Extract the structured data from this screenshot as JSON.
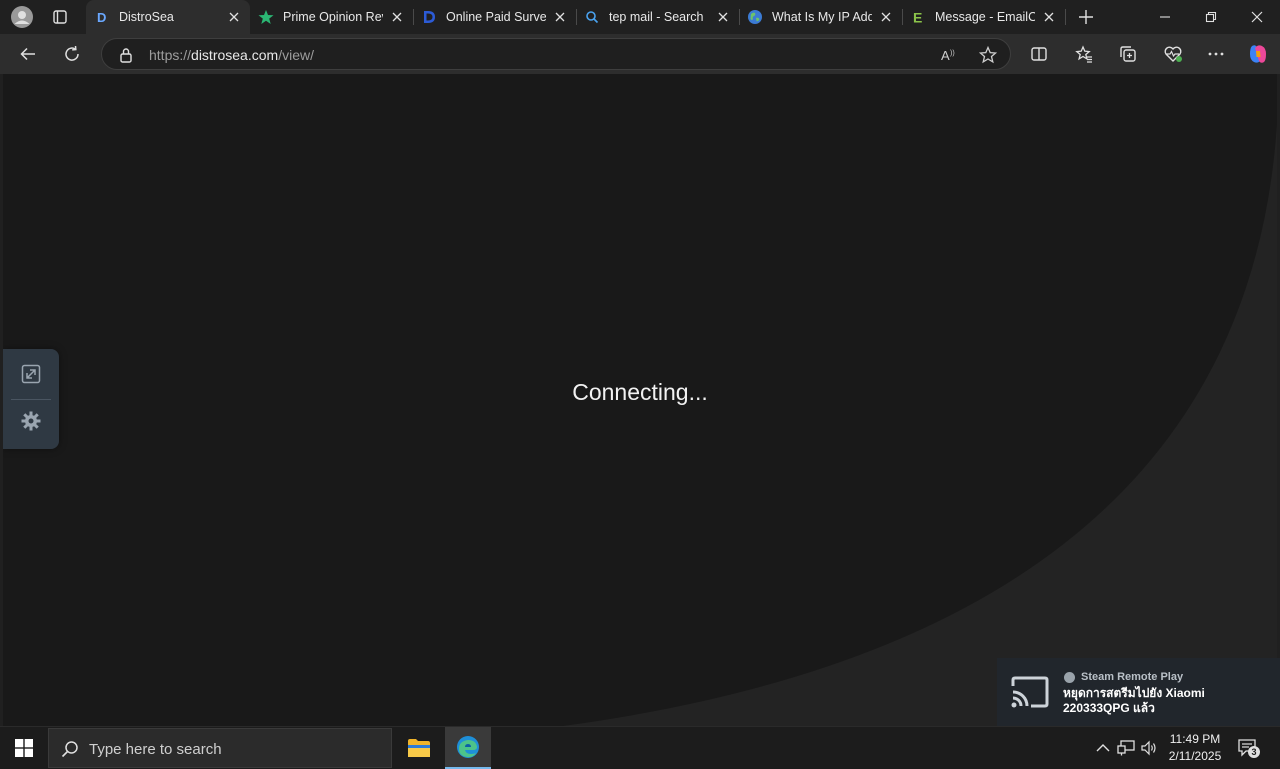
{
  "browser": {
    "tabs": [
      {
        "title": "DistroSea",
        "favicon": "distrosea-d-icon",
        "active": true
      },
      {
        "title": "Prime Opinion Revi",
        "favicon": "green-star-icon"
      },
      {
        "title": "Online Paid Survey",
        "favicon": "blue-d-logo-icon"
      },
      {
        "title": "tep mail - Search",
        "favicon": "search-icon"
      },
      {
        "title": "What Is My IP Add",
        "favicon": "globe-icon"
      },
      {
        "title": "Message - EmailOn",
        "favicon": "green-e-icon"
      }
    ],
    "address": {
      "protocol": "https://",
      "host": "distrosea.com",
      "path": "/view/"
    }
  },
  "page": {
    "status_text": "Connecting..."
  },
  "taskbar": {
    "search_placeholder": "Type here to search",
    "clock_time": "11:49 PM",
    "clock_date": "2/11/2025",
    "notification_count": "3"
  },
  "toast": {
    "app": "Steam Remote Play",
    "message": "หยุดการสตรีมไปยัง Xiaomi 220333QPG แล้ว"
  },
  "colors": {
    "accent": "#76b9ed",
    "page_bg": "#191919",
    "sidepanel_bg": "#2f3943"
  }
}
